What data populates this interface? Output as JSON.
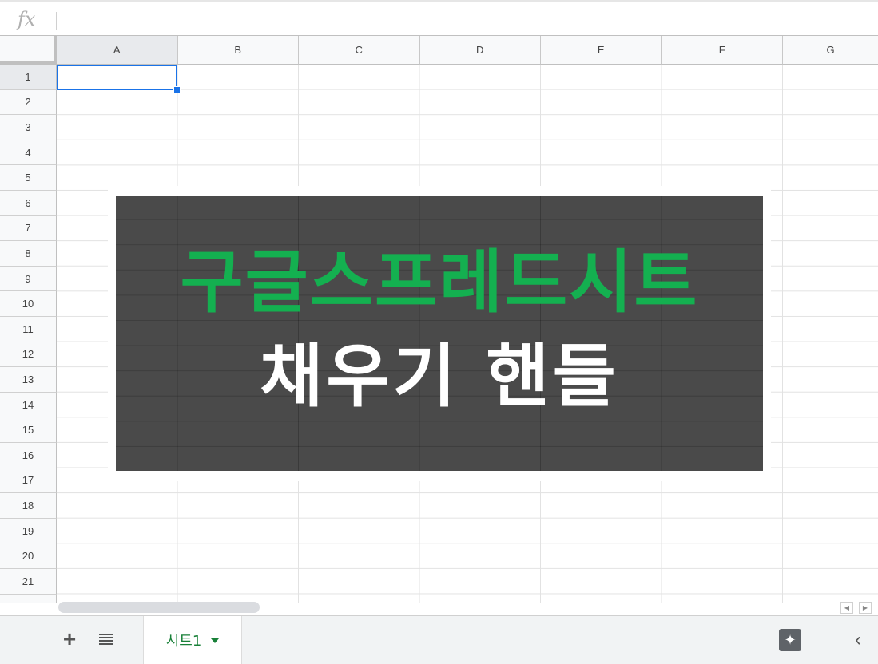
{
  "formula_bar": {
    "fx_label": "fx",
    "value": ""
  },
  "columns": [
    "A",
    "B",
    "C",
    "D",
    "E",
    "F",
    "G"
  ],
  "rows": [
    "1",
    "2",
    "3",
    "4",
    "5",
    "6",
    "7",
    "8",
    "9",
    "10",
    "11",
    "12",
    "13",
    "14",
    "15",
    "16",
    "17",
    "18",
    "19",
    "20",
    "21"
  ],
  "selection": {
    "cell": "A1",
    "accent": "#1a73e8"
  },
  "banner": {
    "title": "구글스프레드시트",
    "subtitle": "채우기 핸들",
    "title_color": "#14b050",
    "subtitle_color": "#ffffff",
    "background": "#4a4a4a"
  },
  "sheets": {
    "active_tab": "시트1",
    "tab_color": "#188038"
  },
  "icons": {
    "add_sheet": "plus-icon",
    "all_sheets": "menu-lines-icon",
    "sheet_menu": "caret-down-icon",
    "explore": "explore-icon",
    "collapse": "chevron-left-icon",
    "scroll_left": "arrow-left-icon",
    "scroll_right": "arrow-right-icon"
  }
}
